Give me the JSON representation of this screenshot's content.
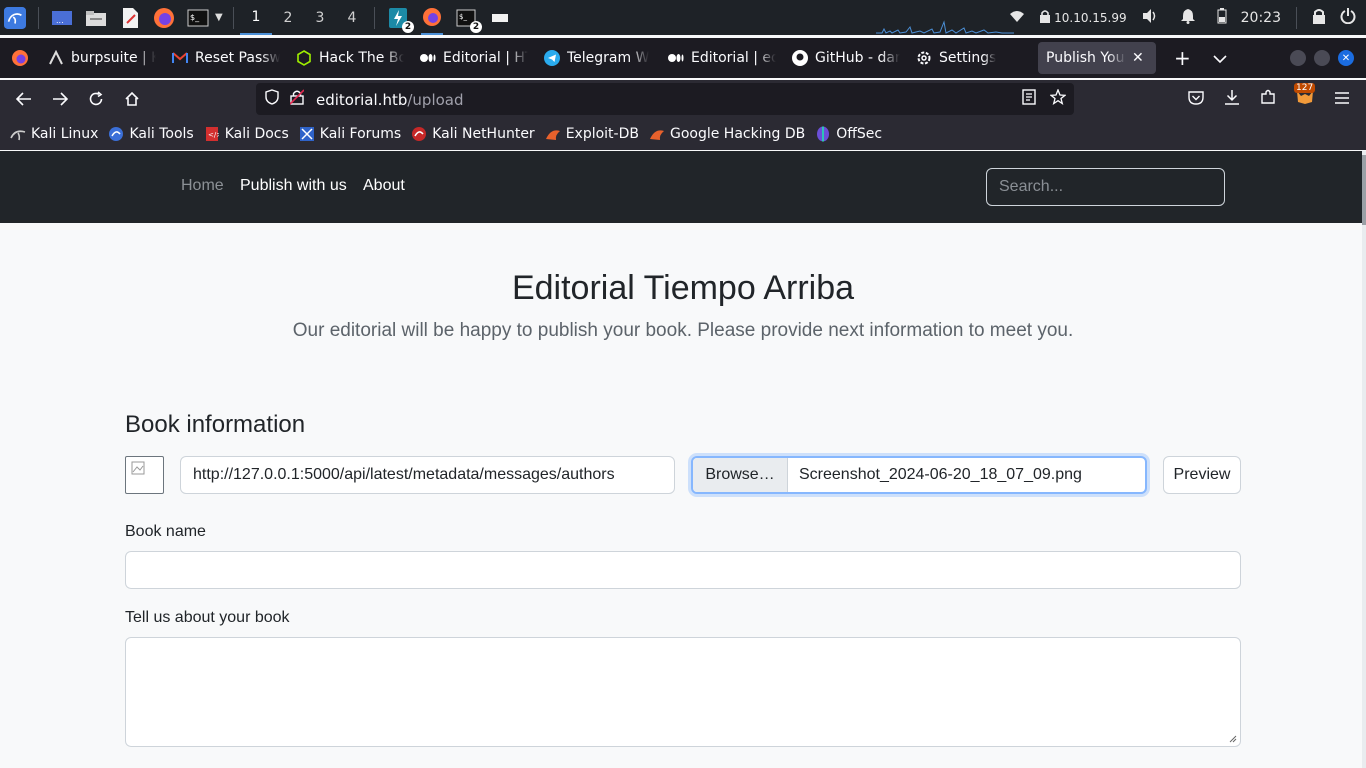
{
  "os_panel": {
    "workspaces": [
      "1",
      "2",
      "3",
      "4"
    ],
    "active_workspace": "1",
    "badge_count_a": "2",
    "badge_count_b": "2",
    "ip_address": "10.10.15.99",
    "clock": "20:23"
  },
  "browser": {
    "tabs": [
      {
        "label": "burpsuite | K",
        "icon": "burp-icon"
      },
      {
        "label": "Reset Passw",
        "icon": "gmail-icon"
      },
      {
        "label": "Hack The Bo",
        "icon": "hackthebox-icon"
      },
      {
        "label": "Editorial | HT",
        "icon": "medium-icon"
      },
      {
        "label": "Telegram W",
        "icon": "telegram-icon"
      },
      {
        "label": "Editorial | ed",
        "icon": "medium-icon"
      },
      {
        "label": "GitHub - dar",
        "icon": "github-icon"
      },
      {
        "label": "Settings",
        "icon": "gear-icon"
      },
      {
        "label": "Publish Your B",
        "icon": "none",
        "active": true
      }
    ],
    "url_host": "editorial.htb",
    "url_path": "/upload",
    "extension_badge": "127",
    "bookmarks": [
      {
        "label": "Kali Linux",
        "icon": "kali-icon"
      },
      {
        "label": "Kali Tools",
        "icon": "kali-tools-icon"
      },
      {
        "label": "Kali Docs",
        "icon": "kali-docs-icon"
      },
      {
        "label": "Kali Forums",
        "icon": "kali-forums-icon"
      },
      {
        "label": "Kali NetHunter",
        "icon": "nethunter-icon"
      },
      {
        "label": "Exploit-DB",
        "icon": "exploit-db-icon"
      },
      {
        "label": "Google Hacking DB",
        "icon": "ghdb-icon"
      },
      {
        "label": "OffSec",
        "icon": "offsec-icon"
      }
    ]
  },
  "site": {
    "nav": {
      "home": "Home",
      "publish": "Publish with us",
      "about": "About"
    },
    "search_placeholder": "Search...",
    "title": "Editorial Tiempo Arriba",
    "subtitle": "Our editorial will be happy to publish your book. Please provide next information to meet you.",
    "section_title": "Book information",
    "cover_url_value": "http://127.0.0.1:5000/api/latest/metadata/messages/authors",
    "browse_label": "Browse…",
    "file_name": "Screenshot_2024-06-20_18_07_09.png",
    "preview_label": "Preview",
    "book_name_label": "Book name",
    "about_label": "Tell us about your book"
  },
  "colors": {
    "panel_bg": "#1e2227",
    "tab_strip_bg": "#1c1b22",
    "toolbar_bg": "#2b2a33",
    "site_nav_bg": "#212529",
    "page_bg": "#f8f9fa",
    "focus_border": "#86b7fe"
  }
}
